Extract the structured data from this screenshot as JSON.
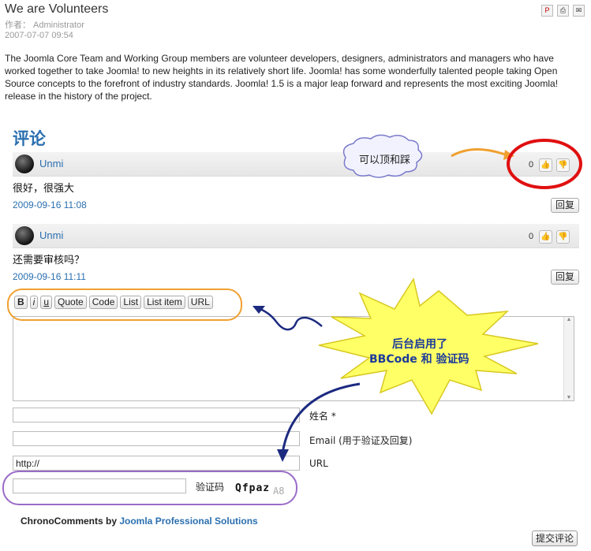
{
  "article": {
    "title": "We are Volunteers",
    "author": "作者： Administrator",
    "date": "2007-07-07 09:54",
    "body": "The Joomla Core Team and Working Group members are volunteer developers, designers, administrators and managers who have worked together to take Joomla! to new heights in its relatively short life. Joomla! has some wonderfully talented people taking Open Source concepts to the forefront of industry standards. Joomla! 1.5 is a major leap forward and represents the most exciting Joomla! release in the history of the project.",
    "icons": [
      "pdf-icon",
      "print-icon",
      "email-icon"
    ]
  },
  "comments_section": {
    "title": "评论",
    "comments": [
      {
        "user": "Unmi",
        "votes": "0",
        "text": "很好，很强大",
        "date": "2009-09-16 11:08",
        "reply_label": "回复"
      },
      {
        "user": "Unmi",
        "votes": "0",
        "text": "还需要审核吗？",
        "date": "2009-09-16 11:11",
        "reply_label": "回复"
      }
    ]
  },
  "editor": {
    "bbcode_buttons": [
      "B",
      "i",
      "u",
      "Quote",
      "Code",
      "List",
      "List item",
      "URL"
    ]
  },
  "form": {
    "name_label": "姓名 *",
    "email_label": "Email (用于验证及回复)",
    "url_value": "http://",
    "url_label": "URL",
    "captcha_label": "验证码",
    "captcha_text": "Qfpaz",
    "captcha_extra": "A8",
    "submit_label": "提交评论"
  },
  "footer": {
    "prefix": "ChronoComments by ",
    "link": "Joomla Professional Solutions"
  },
  "annotations": {
    "vote_callout": "可以顶和踩",
    "star_line1": "后台启用了",
    "star_line2": "BBCode 和 验证码"
  },
  "colors": {
    "link": "#2a6fb0",
    "highlight_orange": "#f0a030",
    "highlight_red": "#e01010",
    "highlight_purple": "#9a6cc8",
    "star_fill": "#ffff66",
    "star_text": "#1c3a9a"
  }
}
